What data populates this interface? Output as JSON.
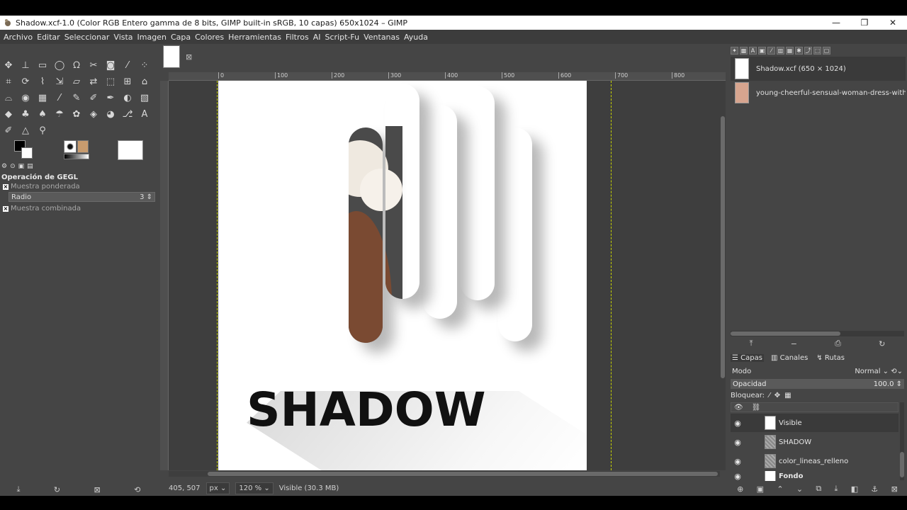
{
  "window": {
    "title": "Shadow.xcf-1.0 (Color RGB Entero gamma de 8 bits, GIMP built-in sRGB, 10 capas) 650x1024 – GIMP",
    "minimize": "—",
    "maximize": "❐",
    "close": "✕"
  },
  "menu": [
    "Archivo",
    "Editar",
    "Seleccionar",
    "Vista",
    "Imagen",
    "Capa",
    "Colores",
    "Herramientas",
    "Filtros",
    "AI",
    "Script-Fu",
    "Ventanas",
    "Ayuda"
  ],
  "toolbox": {
    "tools": [
      {
        "icon": "move-icon",
        "glyph": "✥"
      },
      {
        "icon": "align-icon",
        "glyph": "⊥"
      },
      {
        "icon": "rect-select-icon",
        "glyph": "▭"
      },
      {
        "icon": "ellipse-select-icon",
        "glyph": "◯"
      },
      {
        "icon": "free-select-icon",
        "glyph": "ᘯ"
      },
      {
        "icon": "scissors-select-icon",
        "glyph": "✂"
      },
      {
        "icon": "foreground-select-icon",
        "glyph": "◙"
      },
      {
        "icon": "fuzzy-select-icon",
        "glyph": "⁄"
      },
      {
        "icon": "color-select-icon",
        "glyph": "⁘"
      },
      {
        "icon": "crop-icon",
        "glyph": "⌗"
      },
      {
        "icon": "transform-icon",
        "glyph": "⟳"
      },
      {
        "icon": "warp-icon",
        "glyph": "⌇"
      },
      {
        "icon": "scale-icon",
        "glyph": "⇲"
      },
      {
        "icon": "shear-icon",
        "glyph": "▱"
      },
      {
        "icon": "flip-icon",
        "glyph": "⇄"
      },
      {
        "icon": "perspective-icon",
        "glyph": "⬚"
      },
      {
        "icon": "unified-transform-icon",
        "glyph": "⊞"
      },
      {
        "icon": "handle-transform-icon",
        "glyph": "⌂"
      },
      {
        "icon": "cage-icon",
        "glyph": "⌓"
      },
      {
        "icon": "bucket-fill-icon",
        "glyph": "◉"
      },
      {
        "icon": "gradient-icon",
        "glyph": "▦"
      },
      {
        "icon": "paintbrush-icon",
        "glyph": "⁄"
      },
      {
        "icon": "pencil-icon",
        "glyph": "✎"
      },
      {
        "icon": "airbrush-icon",
        "glyph": "✐"
      },
      {
        "icon": "ink-icon",
        "glyph": "✒"
      },
      {
        "icon": "mypaint-icon",
        "glyph": "◐"
      },
      {
        "icon": "heal-icon",
        "glyph": "▧"
      },
      {
        "icon": "eraser-icon",
        "glyph": "◆"
      },
      {
        "icon": "clone-icon",
        "glyph": "♣"
      },
      {
        "icon": "perspective-clone-icon",
        "glyph": "♠"
      },
      {
        "icon": "smudge-icon",
        "glyph": "☂"
      },
      {
        "icon": "dodge-icon",
        "glyph": "✿"
      },
      {
        "icon": "blur-icon",
        "glyph": "◈"
      },
      {
        "icon": "burn-icon",
        "glyph": "◕"
      },
      {
        "icon": "paths-icon",
        "glyph": "⎇"
      },
      {
        "icon": "text-icon",
        "glyph": "A"
      },
      {
        "icon": "color-picker-icon",
        "glyph": "✐"
      },
      {
        "icon": "measure-icon",
        "glyph": "△"
      },
      {
        "icon": "zoom-icon",
        "glyph": "⚲"
      }
    ]
  },
  "tool_options": {
    "title": "Operación de GEGL",
    "weighted_sample": "Muestra ponderada",
    "radius_label": "Radio",
    "radius_value": "3",
    "merged_sample": "Muestra combinada"
  },
  "canvas": {
    "ruler_marks": [
      "0",
      "100",
      "200",
      "300",
      "400",
      "500",
      "600",
      "700",
      "800"
    ],
    "shadow_text": "SHADOW"
  },
  "status": {
    "coords": "405, 507",
    "unit": "px",
    "zoom": "120 %",
    "info": "Visible (30.3 MB)"
  },
  "images_panel": {
    "items": [
      {
        "label": "Shadow.xcf (650 × 1024)"
      },
      {
        "label": "young-cheerful-sensual-woman-dress-with-beautiful"
      }
    ]
  },
  "layers_panel": {
    "tabs": [
      "Capas",
      "Canales",
      "Rutas"
    ],
    "mode_label": "Modo",
    "mode_value": "Normal",
    "opacity_label": "Opacidad",
    "opacity_value": "100.0",
    "lock_label": "Bloquear:",
    "layers": [
      {
        "name": "Visible",
        "selected": true
      },
      {
        "name": "SHADOW",
        "selected": false
      },
      {
        "name": "color_lineas_relleno",
        "selected": false
      },
      {
        "name": "Fondo",
        "selected": false
      }
    ]
  }
}
